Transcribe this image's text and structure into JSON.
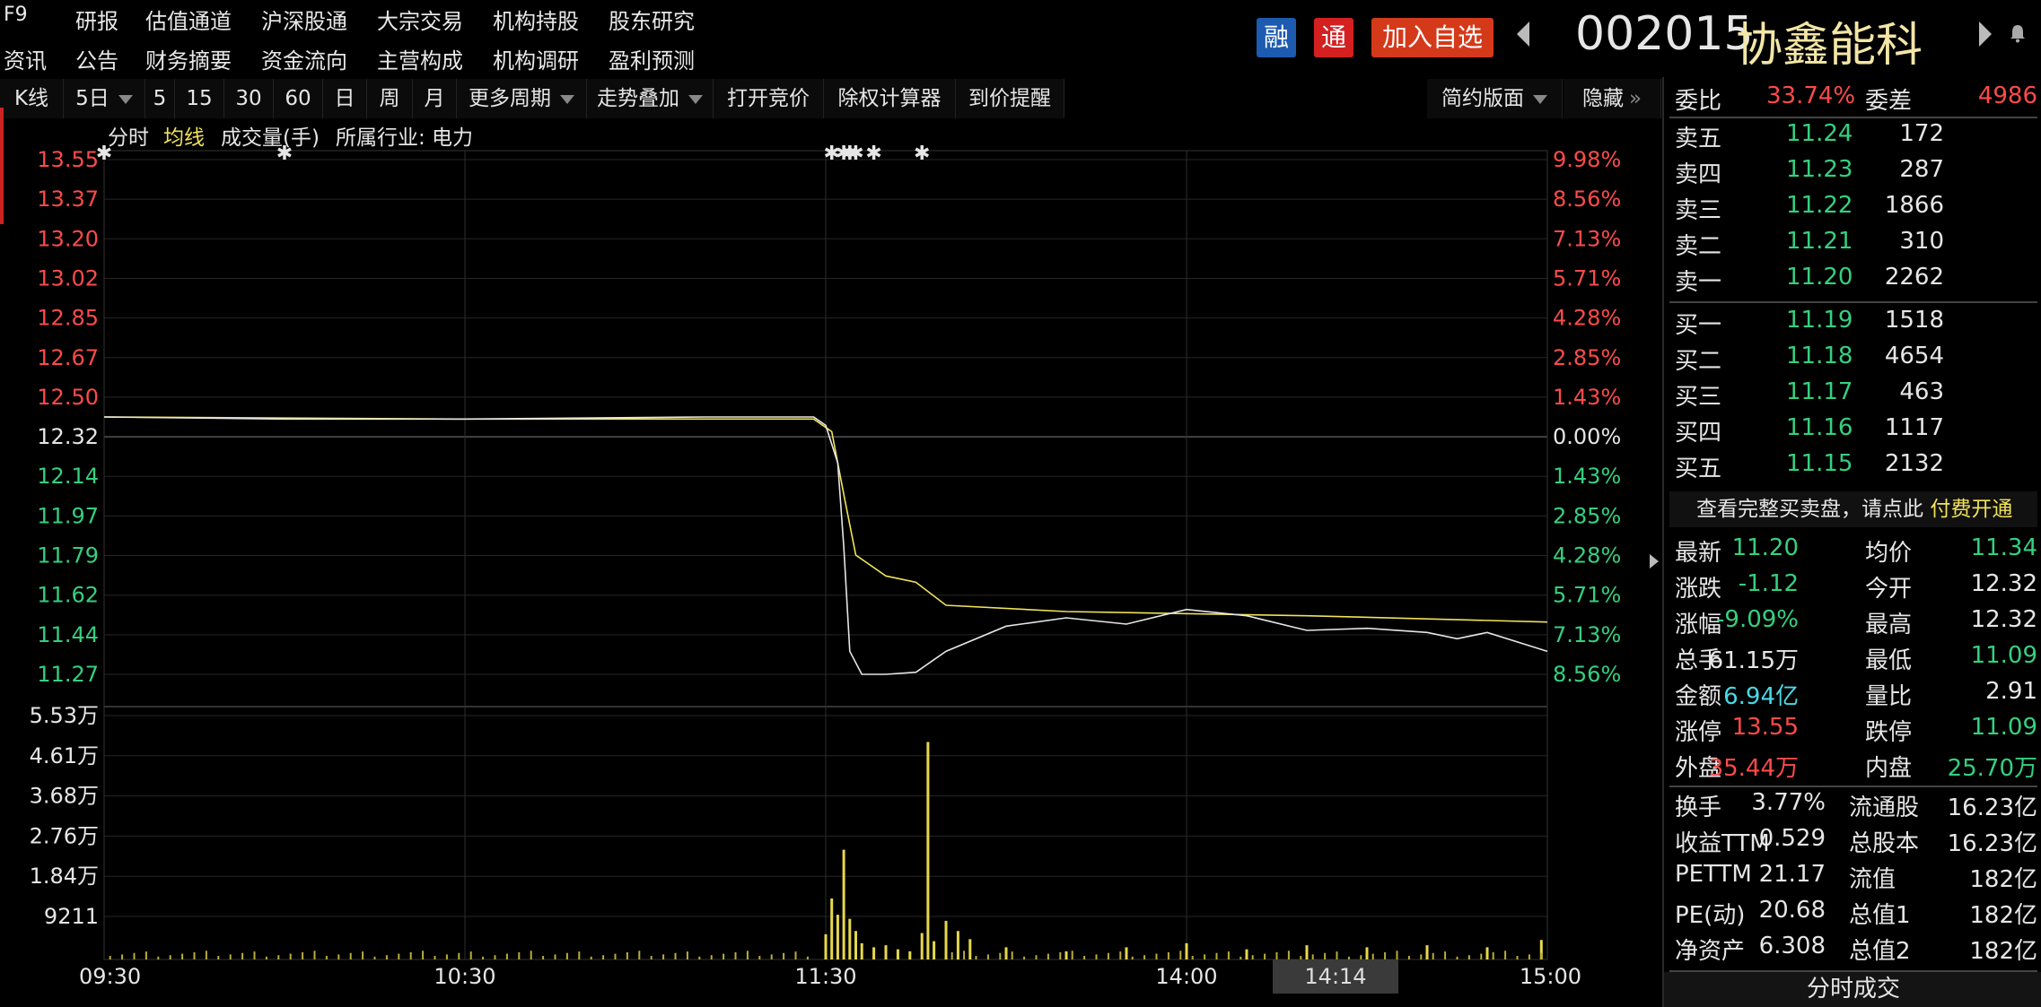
{
  "nav": {
    "row1": [
      "F9",
      "研报",
      "估值通道",
      "沪深股通",
      "大宗交易",
      "机构持股",
      "股东研究"
    ],
    "row2": [
      "资讯",
      "公告",
      "财务摘要",
      "资金流向",
      "主营构成",
      "机构调研",
      "盈利预测"
    ]
  },
  "header": {
    "rong": "融",
    "tong": "通",
    "add_watchlist": "加入自选",
    "code": "002015",
    "name": "协鑫能科"
  },
  "toolbar": {
    "kline": "K线",
    "period": "5日",
    "p5": "5",
    "p15": "15",
    "p30": "30",
    "p60": "60",
    "day": "日",
    "week": "周",
    "month": "月",
    "more_periods": "更多周期",
    "overlay": "走势叠加",
    "auction": "打开竞价",
    "calc": "除权计算器",
    "alert": "到价提醒",
    "layout": "简约版面",
    "hide": "隐藏"
  },
  "subheader": {
    "timeshare": "分时",
    "avgline": "均线",
    "volume": "成交量(手)",
    "industry": "所属行业: 电力"
  },
  "price_axis_left": [
    "13.55",
    "13.37",
    "13.20",
    "13.02",
    "12.85",
    "12.67",
    "12.50",
    "12.32",
    "12.14",
    "11.97",
    "11.79",
    "11.62",
    "11.44",
    "11.27"
  ],
  "pct_axis_right": [
    "9.98%",
    "8.56%",
    "7.13%",
    "5.71%",
    "4.28%",
    "2.85%",
    "1.43%",
    "0.00%",
    "1.43%",
    "2.85%",
    "4.28%",
    "5.71%",
    "7.13%",
    "8.56%"
  ],
  "volume_axis": [
    "5.53万",
    "4.61万",
    "3.68万",
    "2.76万",
    "1.84万",
    "9211"
  ],
  "time_axis": [
    "09:30",
    "10:30",
    "11:30",
    "14:00",
    "15:00"
  ],
  "crosshair_time": "14:14",
  "chart_data": {
    "type": "line",
    "prev_close": 12.32,
    "ylim": [
      11.09,
      13.55
    ],
    "x_ticks": [
      "09:30",
      "10:30",
      "11:30",
      "14:00",
      "15:00"
    ],
    "series": [
      {
        "name": "分时",
        "x_min": [
          0,
          30,
          60,
          100,
          118,
          120,
          122,
          123,
          124,
          126,
          130,
          135,
          140,
          150,
          160,
          170,
          180,
          190,
          200,
          210,
          220,
          225,
          230,
          240
        ],
        "y": [
          12.32,
          12.31,
          12.31,
          12.32,
          12.32,
          12.28,
          12.1,
          11.7,
          11.2,
          11.09,
          11.09,
          11.1,
          11.2,
          11.32,
          11.36,
          11.33,
          11.4,
          11.37,
          11.3,
          11.31,
          11.29,
          11.26,
          11.29,
          11.2
        ]
      },
      {
        "name": "均线",
        "x_min": [
          0,
          60,
          118,
          121,
          123,
          125,
          130,
          135,
          140,
          160,
          200,
          240
        ],
        "y": [
          12.32,
          12.31,
          12.31,
          12.25,
          11.95,
          11.66,
          11.56,
          11.53,
          11.42,
          11.39,
          11.37,
          11.34
        ]
      }
    ],
    "volume": {
      "name": "成交量(手)",
      "x_min": [
        120,
        121,
        122,
        123,
        124,
        125,
        126,
        128,
        130,
        132,
        134,
        136,
        137,
        138,
        140,
        142,
        144,
        150,
        160,
        170,
        180,
        190,
        200,
        210,
        220,
        230,
        239
      ],
      "y": [
        6200,
        15000,
        11000,
        27000,
        10000,
        7000,
        4000,
        3000,
        3500,
        2500,
        2000,
        6500,
        53500,
        4500,
        9500,
        7000,
        5000,
        3000,
        2000,
        3000,
        4000,
        2500,
        3500,
        3000,
        3500,
        3000,
        4800
      ]
    },
    "markers_min": [
      0,
      30,
      121,
      123,
      124,
      125,
      128,
      136
    ]
  },
  "quote": {
    "weibi_label": "委比",
    "weibi": "33.74%",
    "weicha_label": "委差",
    "weicha": "4986",
    "asks": [
      {
        "label": "卖五",
        "price": "11.24",
        "vol": "172"
      },
      {
        "label": "卖四",
        "price": "11.23",
        "vol": "287"
      },
      {
        "label": "卖三",
        "price": "11.22",
        "vol": "1866"
      },
      {
        "label": "卖二",
        "price": "11.21",
        "vol": "310"
      },
      {
        "label": "卖一",
        "price": "11.20",
        "vol": "2262"
      }
    ],
    "bids": [
      {
        "label": "买一",
        "price": "11.19",
        "vol": "1518"
      },
      {
        "label": "买二",
        "price": "11.18",
        "vol": "4654"
      },
      {
        "label": "买三",
        "price": "11.17",
        "vol": "463"
      },
      {
        "label": "买四",
        "price": "11.16",
        "vol": "1117"
      },
      {
        "label": "买五",
        "price": "11.15",
        "vol": "2132"
      }
    ],
    "banner_text": "查看完整买卖盘，请点此",
    "banner_link": "付费开通",
    "stats": [
      {
        "l1": "最新",
        "v1": "11.20",
        "c1": "g",
        "l2": "均价",
        "v2": "11.34",
        "c2": "g"
      },
      {
        "l1": "涨跌",
        "v1": "-1.12",
        "c1": "g",
        "l2": "今开",
        "v2": "12.32",
        "c2": "w"
      },
      {
        "l1": "涨幅",
        "v1": "-9.09%",
        "c1": "g",
        "l2": "最高",
        "v2": "12.32",
        "c2": "w"
      },
      {
        "l1": "总手",
        "v1": "61.15万",
        "c1": "w",
        "l2": "最低",
        "v2": "11.09",
        "c2": "g"
      },
      {
        "l1": "金额",
        "v1": "6.94亿",
        "c1": "c",
        "l2": "量比",
        "v2": "2.91",
        "c2": "w"
      },
      {
        "l1": "涨停",
        "v1": "13.55",
        "c1": "r",
        "l2": "跌停",
        "v2": "11.09",
        "c2": "g"
      },
      {
        "l1": "外盘",
        "v1": "35.44万",
        "c1": "r",
        "l2": "内盘",
        "v2": "25.70万",
        "c2": "g"
      }
    ],
    "fund": [
      {
        "l1": "换手",
        "v1": "3.77%",
        "l2": "流通股",
        "v2": "16.23亿"
      },
      {
        "l1": "收益TTM",
        "v1": "0.529",
        "l2": "总股本",
        "v2": "16.23亿"
      },
      {
        "l1": "PETTM",
        "v1": "21.17",
        "l2": "流值",
        "v2": "182亿"
      },
      {
        "l1": "PE(动)",
        "v1": "20.68",
        "l2": "总值1",
        "v2": "182亿"
      },
      {
        "l1": "净资产",
        "v1": "6.308",
        "l2": "总值2",
        "v2": "182亿"
      }
    ],
    "footer_tab": "分时成交"
  },
  "colors": {
    "up": "#ff4a4a",
    "down": "#35d07f",
    "avg": "#f0e25a",
    "price": "#e6e6e6",
    "volume": "#e6d84a"
  }
}
